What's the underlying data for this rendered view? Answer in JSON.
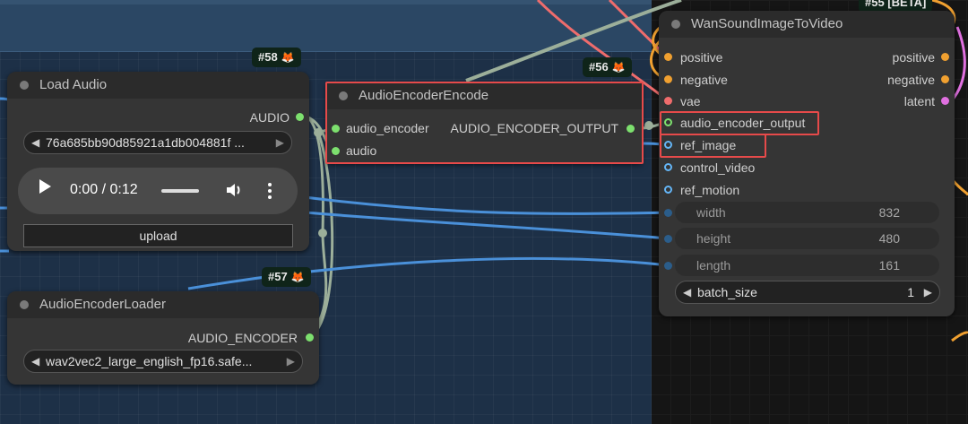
{
  "colors": {
    "group_background": "#1d3047",
    "node_background": "#353535",
    "highlight": "#e64a4a",
    "audio_link": "#7de06e",
    "image_link": "#64b5f6"
  },
  "nodes": {
    "load_audio": {
      "badge": "#58",
      "badge_icon": "🦊",
      "title": "Load Audio",
      "output_label": "AUDIO",
      "file_value": "76a685bb90d85921a1db004881f ...",
      "time_display": "0:00 / 0:12",
      "upload_label": "upload"
    },
    "audio_encoder_encode": {
      "badge": "#56",
      "badge_icon": "🦊",
      "title": "AudioEncoderEncode",
      "input_audio_encoder": "audio_encoder",
      "output_label": "AUDIO_ENCODER_OUTPUT",
      "input_audio": "audio"
    },
    "audio_encoder_loader": {
      "badge": "#57",
      "badge_icon": "🦊",
      "title": "AudioEncoderLoader",
      "output_label": "AUDIO_ENCODER",
      "model_value": "wav2vec2_large_english_fp16.safe..."
    },
    "wan_sound_image_to_video": {
      "badge": "#55 [BETA]",
      "title": "WanSoundImageToVideo",
      "inputs": [
        "positive",
        "negative",
        "vae",
        "audio_encoder_output",
        "ref_image",
        "control_video",
        "ref_motion"
      ],
      "outputs": [
        "positive",
        "negative",
        "latent"
      ],
      "width": {
        "label": "width",
        "value": "832"
      },
      "height": {
        "label": "height",
        "value": "480"
      },
      "length": {
        "label": "length",
        "value": "161"
      },
      "batch_size": {
        "label": "batch_size",
        "value": "1"
      }
    }
  }
}
